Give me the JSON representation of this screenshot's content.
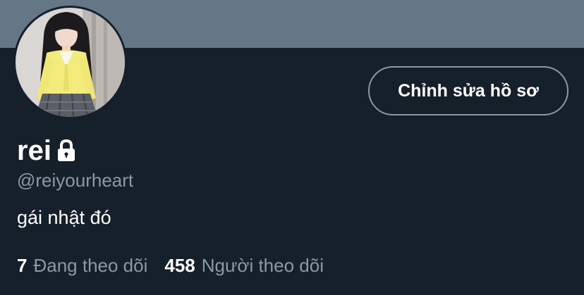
{
  "colors": {
    "background": "#15202b",
    "banner": "#657786",
    "primary_text": "#ffffff",
    "secondary_text": "#8b98a5",
    "button_border": "#8b98a5"
  },
  "profile": {
    "display_name": "rei",
    "protected_icon": "lock-icon",
    "handle": "@reiyourheart",
    "bio": "gái nhật đó",
    "edit_button_label": "Chỉnh sửa hồ sơ"
  },
  "stats": {
    "following_count": "7",
    "following_label": "Đang theo dõi",
    "followers_count": "458",
    "followers_label": "Người theo dõi"
  }
}
